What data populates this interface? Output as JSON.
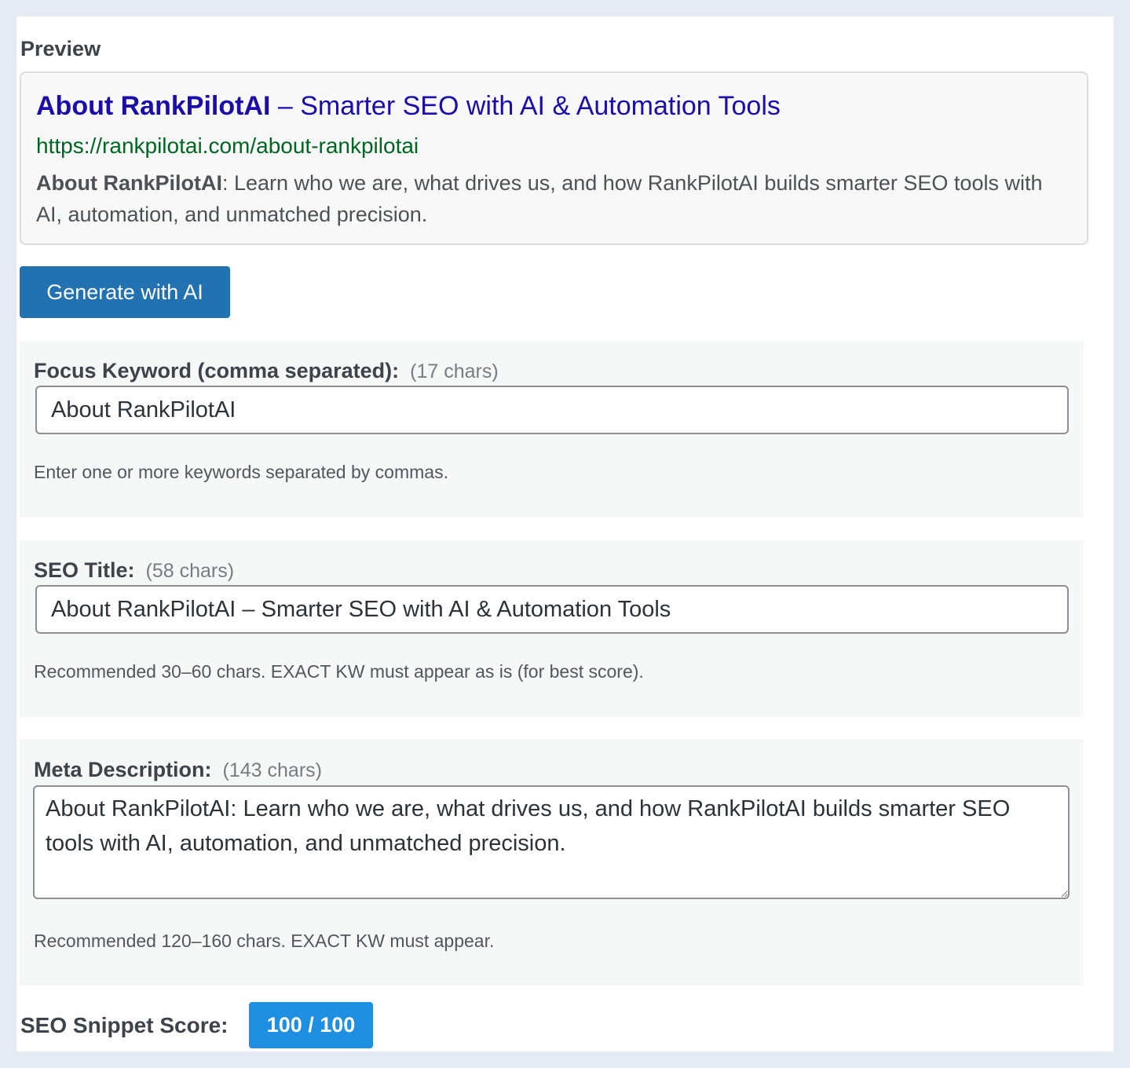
{
  "preview": {
    "heading": "Preview",
    "title_keyword": "About RankPilotAI",
    "title_rest": " – Smarter SEO with AI & Automation Tools",
    "url": "https://rankpilotai.com/about-rankpilotai",
    "desc_keyword": "About RankPilotAI",
    "desc_rest": ": Learn who we are, what drives us, and how RankPilotAI builds smarter SEO tools with AI, automation, and unmatched precision."
  },
  "generate_button": {
    "label": "Generate with AI"
  },
  "focus_keyword": {
    "label": "Focus Keyword (comma separated):",
    "count": "(17 chars)",
    "value": "About RankPilotAI",
    "hint": "Enter one or more keywords separated by commas."
  },
  "seo_title": {
    "label": "SEO Title:",
    "count": "(58 chars)",
    "value": "About RankPilotAI – Smarter SEO with AI & Automation Tools",
    "hint": "Recommended 30–60 chars. EXACT KW must appear as is (for best score)."
  },
  "meta_description": {
    "label": "Meta Description:",
    "count": "(143 chars)",
    "value": "About RankPilotAI: Learn who we are, what drives us, and how RankPilotAI builds smarter SEO tools with AI, automation, and unmatched precision.",
    "hint": "Recommended 120–160 chars. EXACT KW must appear."
  },
  "score": {
    "label": "SEO Snippet Score:",
    "value": "100 / 100"
  },
  "colors": {
    "page_background": "#e4ebf3",
    "preview_title": "#1a0dab",
    "preview_url": "#006621",
    "primary_button": "#2271b1",
    "score_badge": "#1e8fe1"
  }
}
